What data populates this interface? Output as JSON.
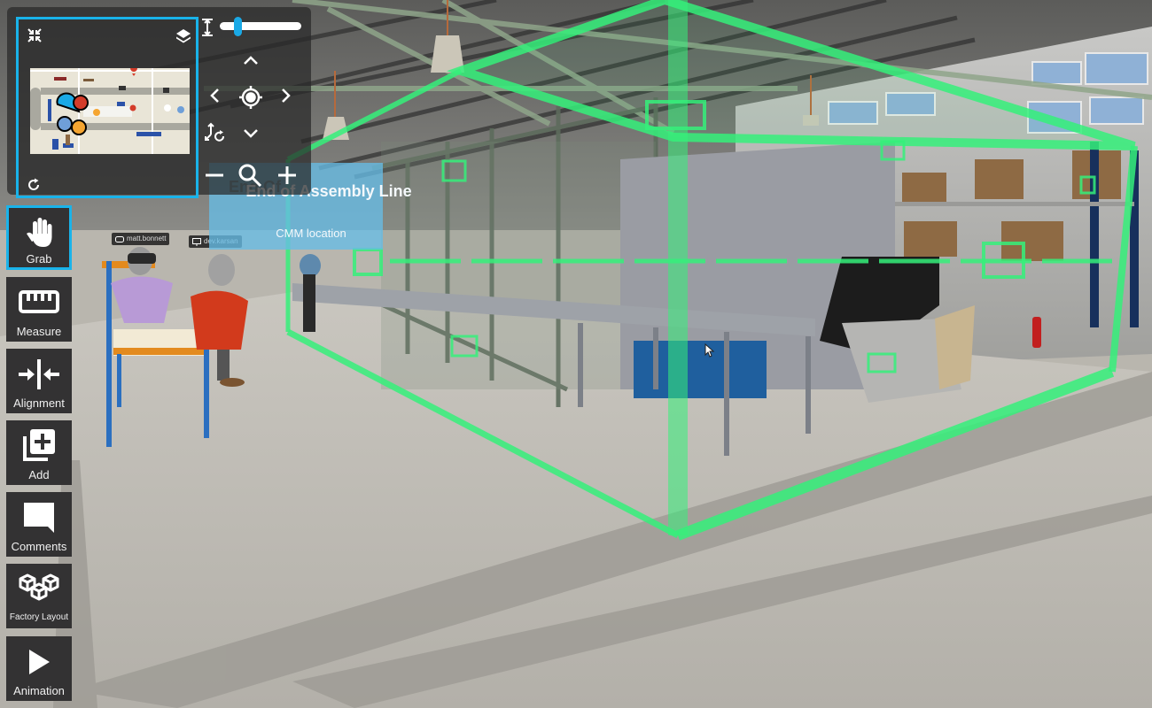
{
  "app": {
    "accent_color": "#19b3ea",
    "highlight_box_color": "#35f07a"
  },
  "minimap": {
    "collapse_icon": "collapse-arrows-icon",
    "layers_icon": "layers-icon",
    "reset_icon": "refresh-icon",
    "markers": [
      {
        "color": "#1aa9e6",
        "kind": "user"
      },
      {
        "color": "#d43c2a",
        "kind": "user"
      },
      {
        "color": "#6f9fd8",
        "kind": "user"
      },
      {
        "color": "#f5a531",
        "kind": "user"
      }
    ]
  },
  "navigation": {
    "height_icon": "height-icon",
    "height_slider_value": 0.22,
    "up_icon": "chevron-up-icon",
    "down_icon": "chevron-down-icon",
    "left_icon": "chevron-left-icon",
    "right_icon": "chevron-right-icon",
    "recenter_icon": "crosshair-icon",
    "rotate_axes_icon": "rotate-axes-icon",
    "zoom_out_icon": "minus-icon",
    "zoom_icon": "magnifier-icon",
    "zoom_in_icon": "plus-icon"
  },
  "location_label": {
    "title": "End of Assembly Line",
    "subtitle": "CMM location",
    "obscured_prefix": "End Of"
  },
  "users": [
    {
      "name": "matt.bonnett",
      "device": "vr-headset-icon"
    },
    {
      "name": "dev.karsan",
      "device": "monitor-icon"
    }
  ],
  "tools": [
    {
      "label": "Grab",
      "icon": "hand-icon",
      "active": true
    },
    {
      "label": "Measure",
      "icon": "ruler-icon",
      "active": false
    },
    {
      "label": "Alignment",
      "icon": "alignment-icon",
      "active": false
    },
    {
      "label": "Add",
      "icon": "add-layers-icon",
      "active": false
    },
    {
      "label": "Comments",
      "icon": "comment-icon",
      "active": false
    },
    {
      "label": "Factory Layout",
      "icon": "cubes-icon",
      "active": false
    },
    {
      "label": "Animation",
      "icon": "play-icon",
      "active": false
    }
  ]
}
